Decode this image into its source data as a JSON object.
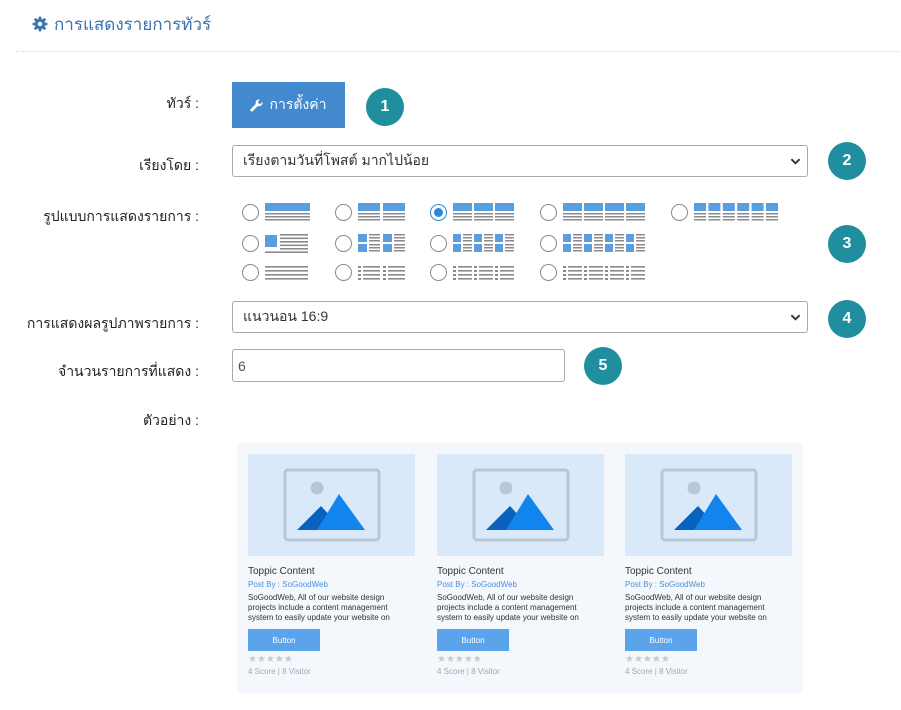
{
  "header": {
    "title": "การแสดงรายการทัวร์",
    "icon": "gear-icon",
    "accent": "#3a73b0"
  },
  "form": {
    "tour": {
      "label": "ทัวร์ :",
      "button_label": "การตั้งค่า",
      "button_icon": "wrench-icon",
      "step": "1"
    },
    "sort": {
      "label": "เรียงโดย :",
      "value": "เรียงตามวันที่โพสต์ มากไปน้อย",
      "step": "2"
    },
    "layout": {
      "label": "รูปแบบการแสดงรายการ :",
      "step": "3",
      "selected": "grid-3",
      "options": [
        "list-1",
        "grid-2",
        "grid-3",
        "grid-4",
        "grid-6",
        "thumb-1",
        "thumb-2",
        "thumb-3",
        "thumb-4",
        "text-1",
        "text-2",
        "text-3",
        "text-4"
      ]
    },
    "image_ratio": {
      "label": "การแสดงผลรูปภาพรายการ :",
      "value": "แนวนอน 16:9",
      "step": "4"
    },
    "count": {
      "label": "จำนวนรายการที่แสดง :",
      "value": "6",
      "step": "5"
    },
    "preview": {
      "label": "ตัวอย่าง :"
    }
  },
  "preview_cards": [
    {
      "title": "Toppic Content",
      "by": "Post By : SoGoodWeb",
      "desc": "SoGoodWeb, All of our website design projects include a content management system to easily update your website on",
      "button": "Button",
      "stars": "★★★★★",
      "stats": "4 Score | 8 Visitor"
    },
    {
      "title": "Toppic Content",
      "by": "Post By : SoGoodWeb",
      "desc": "SoGoodWeb, All of our website design projects include a content management system to easily update your website on",
      "button": "Button",
      "stars": "★★★★★",
      "stats": "4 Score | 8 Visitor"
    },
    {
      "title": "Toppic Content",
      "by": "Post By : SoGoodWeb",
      "desc": "SoGoodWeb, All of our website design projects include a content management system to easily update your website on",
      "button": "Button",
      "stars": "★★★★★",
      "stats": "4 Score | 8 Visitor"
    }
  ],
  "colors": {
    "button": "#4389cf",
    "badge": "#1f8fa0",
    "radio_checked": "#2b8ad8",
    "thumb_blue": "#5a9fdc"
  }
}
